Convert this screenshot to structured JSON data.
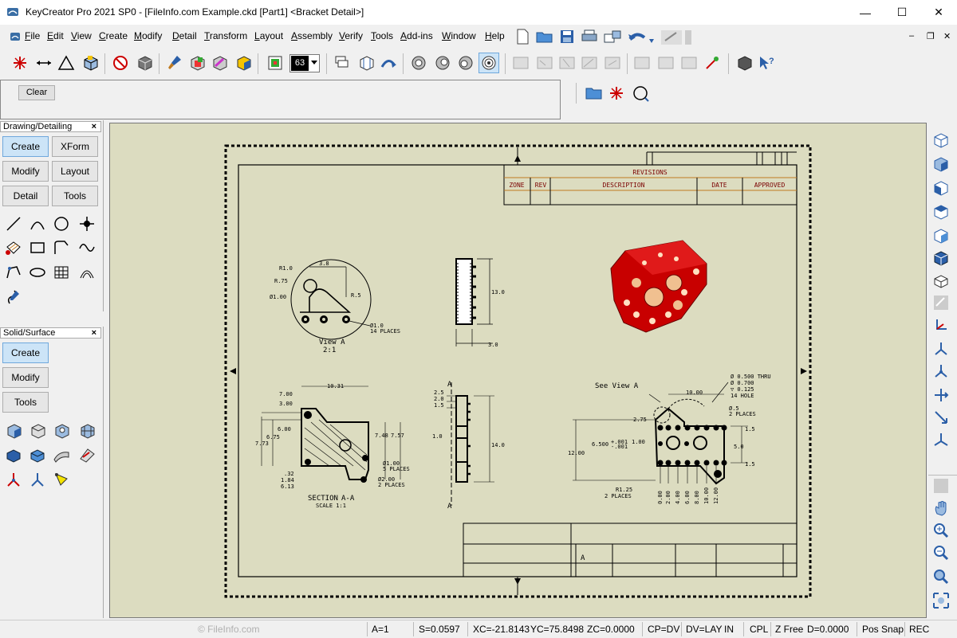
{
  "window": {
    "title": "KeyCreator Pro 2021 SP0 - [FileInfo.com Example.ckd [Part1] <Bracket Detail>]",
    "minimize": "—",
    "maximize": "☐",
    "close": "✕"
  },
  "menu": {
    "items": [
      {
        "id": "file",
        "label": "File",
        "accel": "F",
        "rest": "ile"
      },
      {
        "id": "edit",
        "label": "Edit",
        "accel": "E",
        "rest": "dit"
      },
      {
        "id": "view",
        "label": "View",
        "accel": "V",
        "rest": "iew"
      },
      {
        "id": "create",
        "label": "Create",
        "accel": "C",
        "rest": "reate"
      },
      {
        "id": "modify",
        "label": "Modify",
        "accel": "M",
        "rest": "odify"
      },
      {
        "id": "detail",
        "label": "Detail",
        "accel": "D",
        "rest": "etail"
      },
      {
        "id": "transform",
        "label": "Transform",
        "accel": "T",
        "rest": "ransform"
      },
      {
        "id": "layout",
        "label": "Layout",
        "accel": "L",
        "rest": "ayout"
      },
      {
        "id": "assembly",
        "label": "Assembly",
        "accel": "A",
        "rest": "ssembly"
      },
      {
        "id": "verify",
        "label": "Verify",
        "accel": "V",
        "rest": "erify"
      },
      {
        "id": "tools",
        "label": "Tools",
        "accel": "T",
        "rest": "ools"
      },
      {
        "id": "addins",
        "label": "Add-ins",
        "accel": "A",
        "rest": "dd-ins"
      },
      {
        "id": "window",
        "label": "Window",
        "accel": "W",
        "rest": "indow"
      },
      {
        "id": "help",
        "label": "Help",
        "accel": "H",
        "rest": "elp"
      }
    ],
    "mdi_minimize": "–",
    "mdi_restore": "❐",
    "mdi_close": "✕"
  },
  "toolbar": {
    "layer_value": "63"
  },
  "prompt": {
    "clear_label": "Clear"
  },
  "panels": {
    "drawing": {
      "title": "Drawing/Detailing",
      "close": "×",
      "buttons": [
        "Create",
        "XForm",
        "Modify",
        "Layout",
        "Detail",
        "Tools"
      ]
    },
    "solid": {
      "title": "Solid/Surface",
      "close": "×",
      "buttons": [
        "Create",
        "Modify",
        "Tools"
      ]
    }
  },
  "drawing": {
    "revisions_title": "REVISIONS",
    "rev_headers": [
      "ZONE",
      "REV",
      "DESCRIPTION",
      "DATE",
      "APPROVED"
    ],
    "view_a": "View A",
    "view_a_scale": "2:1",
    "section": "SECTION",
    "section_letters": "A-A",
    "section_scale": "SCALE 1:1",
    "see_view_a": "See View A",
    "section_mark": "A",
    "size_letter": "A",
    "dims": {
      "r10": "R1.0",
      "r75": "R.75",
      "d100": "Ø1.00",
      "d38": "3.8",
      "r5": "R.5",
      "d10note": "Ø1.0",
      "places14": "14 PLACES",
      "d130": "13.0",
      "d30": "3.0",
      "d700": "7.00",
      "d300": "3.00",
      "d1031": "10.31",
      "d600": "6.00",
      "d675": "6.75",
      "d773": "7.73",
      "d748": "7.48",
      "d757": "7.57",
      "d32": ".32",
      "d184": "1.84",
      "d613": "6.13",
      "d100b": "Ø1.00",
      "places5": "5 PLACES",
      "d200": "Ø2.00",
      "places2": "2 PLACES",
      "d25": "2.5",
      "d20": "2.0",
      "d15": "1.5",
      "d10": "1.0",
      "d140": "14.0",
      "d1000": "10.00",
      "d275": "2.75",
      "d500hole": "Ø 0.500 THRU",
      "d700hole": "Ø 0.700",
      "d125": "▽ 0.125",
      "hole14": "14 HOLE",
      "d05": "Ø.5",
      "places2b": "2 PLACES",
      "d6500": "6.500",
      "d001a": "+.001",
      "d001b": "-.001",
      "d100c": "1.00",
      "d1200": "12.00",
      "d15b": "1.5",
      "d50": "5.0",
      "d15c": "1.5",
      "r125": "R1.25",
      "places2c": "2 PLACES",
      "xdims": [
        "0.00",
        "2.00",
        "4.00",
        "6.00",
        "8.00",
        "10.00",
        "12.00"
      ]
    }
  },
  "status": {
    "watermark": "© FileInfo.com",
    "a": "A=1",
    "s": "S=0.0597",
    "xc": "XC=-21.8143",
    "yc": "YC=75.8498",
    "zc": "ZC=0.0000",
    "cp": "CP=DV",
    "dv": "DV=LAY",
    "in": "IN",
    "cpl": "CPL",
    "zfree": "Z Free",
    "d": "D=0.0000",
    "possnap": "Pos Snap",
    "rec": "REC"
  }
}
